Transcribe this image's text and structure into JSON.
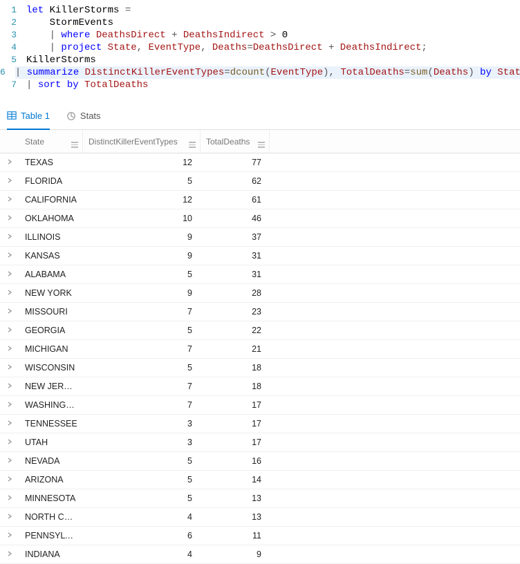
{
  "editor": {
    "lines": [
      {
        "n": "1",
        "tokens": [
          {
            "t": "let",
            "c": "kw"
          },
          {
            "t": " ",
            "c": ""
          },
          {
            "t": "KillerStorms",
            "c": "id"
          },
          {
            "t": " = ",
            "c": "op"
          }
        ]
      },
      {
        "n": "2",
        "tokens": [
          {
            "t": "    ",
            "c": ""
          },
          {
            "t": "StormEvents",
            "c": "id"
          }
        ]
      },
      {
        "n": "3",
        "tokens": [
          {
            "t": "    | ",
            "c": "op"
          },
          {
            "t": "where",
            "c": "kw"
          },
          {
            "t": " ",
            "c": ""
          },
          {
            "t": "DeathsDirect",
            "c": "fld"
          },
          {
            "t": " + ",
            "c": "op"
          },
          {
            "t": "DeathsIndirect",
            "c": "fld"
          },
          {
            "t": " > ",
            "c": "op"
          },
          {
            "t": "0",
            "c": "id"
          }
        ]
      },
      {
        "n": "4",
        "tokens": [
          {
            "t": "    | ",
            "c": "op"
          },
          {
            "t": "project",
            "c": "kw"
          },
          {
            "t": " ",
            "c": ""
          },
          {
            "t": "State",
            "c": "fld"
          },
          {
            "t": ", ",
            "c": "op"
          },
          {
            "t": "EventType",
            "c": "fld"
          },
          {
            "t": ", ",
            "c": "op"
          },
          {
            "t": "Deaths",
            "c": "fld"
          },
          {
            "t": "=",
            "c": "op"
          },
          {
            "t": "DeathsDirect",
            "c": "fld"
          },
          {
            "t": " + ",
            "c": "op"
          },
          {
            "t": "DeathsIndirect",
            "c": "fld"
          },
          {
            "t": ";",
            "c": "op"
          }
        ]
      },
      {
        "n": "5",
        "tokens": [
          {
            "t": "KillerStorms",
            "c": "id"
          }
        ]
      },
      {
        "n": "6",
        "hl": true,
        "tokens": [
          {
            "t": "| ",
            "c": "op"
          },
          {
            "t": "summarize",
            "c": "kw"
          },
          {
            "t": " ",
            "c": ""
          },
          {
            "t": "DistinctKillerEventTypes",
            "c": "fld"
          },
          {
            "t": "=",
            "c": "op"
          },
          {
            "t": "dcount",
            "c": "func"
          },
          {
            "t": "(",
            "c": "op"
          },
          {
            "t": "EventType",
            "c": "fld"
          },
          {
            "t": "), ",
            "c": "op"
          },
          {
            "t": "TotalDeaths",
            "c": "fld"
          },
          {
            "t": "=",
            "c": "op"
          },
          {
            "t": "sum",
            "c": "func"
          },
          {
            "t": "(",
            "c": "op"
          },
          {
            "t": "Deaths",
            "c": "fld"
          },
          {
            "t": ") ",
            "c": "op"
          },
          {
            "t": "by",
            "c": "kw"
          },
          {
            "t": " ",
            "c": ""
          },
          {
            "t": "State",
            "c": "fld"
          }
        ]
      },
      {
        "n": "7",
        "tokens": [
          {
            "t": "| ",
            "c": "op"
          },
          {
            "t": "sort",
            "c": "kw"
          },
          {
            "t": " ",
            "c": ""
          },
          {
            "t": "by",
            "c": "kw"
          },
          {
            "t": " ",
            "c": ""
          },
          {
            "t": "TotalDeaths",
            "c": "fld"
          }
        ]
      }
    ]
  },
  "tabs": {
    "table_label": "Table 1",
    "stats_label": "Stats"
  },
  "columns": {
    "state": "State",
    "types": "DistinctKillerEventTypes",
    "deaths": "TotalDeaths"
  },
  "rows": [
    {
      "state": "TEXAS",
      "types": "12",
      "deaths": "77"
    },
    {
      "state": "FLORIDA",
      "types": "5",
      "deaths": "62"
    },
    {
      "state": "CALIFORNIA",
      "types": "12",
      "deaths": "61"
    },
    {
      "state": "OKLAHOMA",
      "types": "10",
      "deaths": "46"
    },
    {
      "state": "ILLINOIS",
      "types": "9",
      "deaths": "37"
    },
    {
      "state": "KANSAS",
      "types": "9",
      "deaths": "31"
    },
    {
      "state": "ALABAMA",
      "types": "5",
      "deaths": "31"
    },
    {
      "state": "NEW YORK",
      "types": "9",
      "deaths": "28"
    },
    {
      "state": "MISSOURI",
      "types": "7",
      "deaths": "23"
    },
    {
      "state": "GEORGIA",
      "types": "5",
      "deaths": "22"
    },
    {
      "state": "MICHIGAN",
      "types": "7",
      "deaths": "21"
    },
    {
      "state": "WISCONSIN",
      "types": "5",
      "deaths": "18"
    },
    {
      "state": "NEW JERSEY",
      "types": "7",
      "deaths": "18"
    },
    {
      "state": "WASHINGT…",
      "types": "7",
      "deaths": "17"
    },
    {
      "state": "TENNESSEE",
      "types": "3",
      "deaths": "17"
    },
    {
      "state": "UTAH",
      "types": "3",
      "deaths": "17"
    },
    {
      "state": "NEVADA",
      "types": "5",
      "deaths": "16"
    },
    {
      "state": "ARIZONA",
      "types": "5",
      "deaths": "14"
    },
    {
      "state": "MINNESOTA",
      "types": "5",
      "deaths": "13"
    },
    {
      "state": "NORTH CA…",
      "types": "4",
      "deaths": "13"
    },
    {
      "state": "PENNSYLV…",
      "types": "6",
      "deaths": "11"
    },
    {
      "state": "INDIANA",
      "types": "4",
      "deaths": "9"
    }
  ]
}
